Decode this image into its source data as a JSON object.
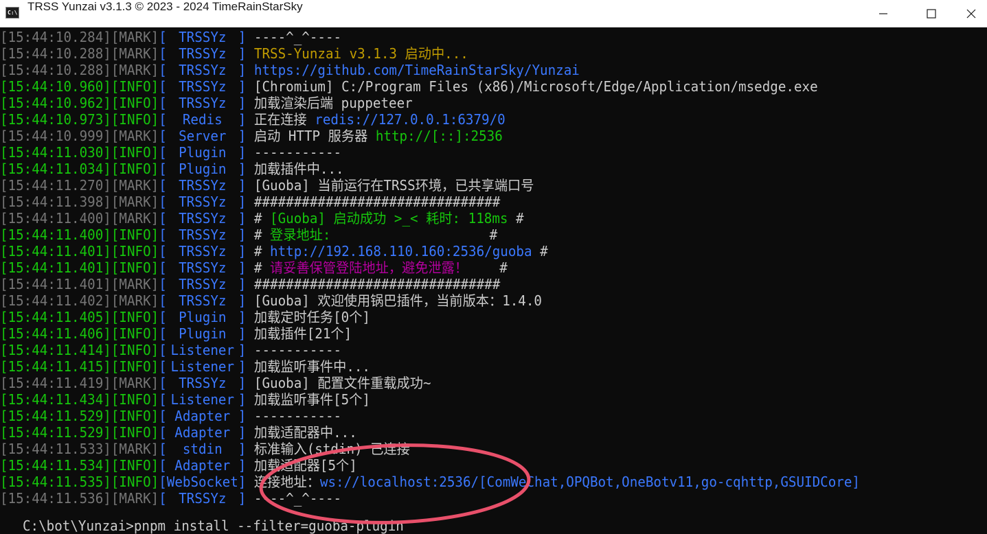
{
  "window": {
    "title": "TRSS Yunzai v3.1.3 © 2023 - 2024 TimeRainStarSky",
    "icon_text": "C:\\",
    "controls": [
      "minimize-icon",
      "maximize-icon",
      "close-icon"
    ]
  },
  "colors": {
    "timestamp": "#767676",
    "info": "#16c60c",
    "bracket_source": "#3b78ff",
    "message": "#cccccc",
    "yellow": "#c19c00",
    "link": "#3b78ff",
    "green": "#16c60c",
    "magenta": "#b4009e",
    "annotation_circle": "#e8506a"
  },
  "log": [
    {
      "time": "[15:44:10.284]",
      "level": "[MARK]",
      "source": "TRSSYz",
      "segments": [
        {
          "t": "----^_^----",
          "c": "msg"
        }
      ]
    },
    {
      "time": "[15:44:10.288]",
      "level": "[MARK]",
      "source": "TRSSYz",
      "segments": [
        {
          "t": "TRSS-Yunzai v3.1.3 启动中...",
          "c": "yellow"
        }
      ]
    },
    {
      "time": "[15:44:10.288]",
      "level": "[MARK]",
      "source": "TRSSYz",
      "segments": [
        {
          "t": "https://github.com/TimeRainStarSky/Yunzai",
          "c": "blue"
        }
      ]
    },
    {
      "time": "[15:44:10.960]",
      "level": "[INFO]",
      "source": "TRSSYz",
      "segments": [
        {
          "t": "[Chromium] C:/Program Files (x86)/Microsoft/Edge/Application/msedge.exe",
          "c": "msg"
        }
      ]
    },
    {
      "time": "[15:44:10.962]",
      "level": "[INFO]",
      "source": "TRSSYz",
      "segments": [
        {
          "t": "加载渲染后端 puppeteer",
          "c": "msg"
        }
      ]
    },
    {
      "time": "[15:44:10.973]",
      "level": "[INFO]",
      "source": "Redis",
      "segments": [
        {
          "t": "正在连接 ",
          "c": "msg"
        },
        {
          "t": "redis://127.0.0.1:6379/0",
          "c": "blue"
        }
      ]
    },
    {
      "time": "[15:44:10.999]",
      "level": "[MARK]",
      "source": "Server",
      "segments": [
        {
          "t": "启动 HTTP 服务器 ",
          "c": "msg"
        },
        {
          "t": "http://[::]:2536",
          "c": "green"
        }
      ]
    },
    {
      "time": "[15:44:11.030]",
      "level": "[INFO]",
      "source": "Plugin",
      "segments": [
        {
          "t": "-----------",
          "c": "msg"
        }
      ]
    },
    {
      "time": "[15:44:11.034]",
      "level": "[INFO]",
      "source": "Plugin",
      "segments": [
        {
          "t": "加载插件中...",
          "c": "msg"
        }
      ]
    },
    {
      "time": "[15:44:11.270]",
      "level": "[MARK]",
      "source": "TRSSYz",
      "segments": [
        {
          "t": "[Guoba] 当前运行在TRSS环境，已共享端口号",
          "c": "msg"
        }
      ]
    },
    {
      "time": "[15:44:11.398]",
      "level": "[MARK]",
      "source": "TRSSYz",
      "segments": [
        {
          "t": "###############################",
          "c": "msg"
        }
      ]
    },
    {
      "time": "[15:44:11.400]",
      "level": "[MARK]",
      "source": "TRSSYz",
      "segments": [
        {
          "t": "# ",
          "c": "msg"
        },
        {
          "t": "[Guoba] 启动成功 >_< 耗时: 118ms",
          "c": "green"
        },
        {
          "t": " #",
          "c": "msg"
        }
      ]
    },
    {
      "time": "[15:44:11.400]",
      "level": "[INFO]",
      "source": "TRSSYz",
      "segments": [
        {
          "t": "# ",
          "c": "msg"
        },
        {
          "t": "登录地址:",
          "c": "green"
        },
        {
          "t": "                    #",
          "c": "msg"
        }
      ]
    },
    {
      "time": "[15:44:11.401]",
      "level": "[INFO]",
      "source": "TRSSYz",
      "segments": [
        {
          "t": "# ",
          "c": "msg"
        },
        {
          "t": "http://192.168.110.160:2536/guoba",
          "c": "blue"
        },
        {
          "t": " #",
          "c": "msg"
        }
      ]
    },
    {
      "time": "[15:44:11.401]",
      "level": "[INFO]",
      "source": "TRSSYz",
      "segments": [
        {
          "t": "# ",
          "c": "msg"
        },
        {
          "t": "请妥善保管登陆地址，避免泄露！",
          "c": "magenta"
        },
        {
          "t": "    #",
          "c": "msg"
        }
      ]
    },
    {
      "time": "[15:44:11.401]",
      "level": "[MARK]",
      "source": "TRSSYz",
      "segments": [
        {
          "t": "###############################",
          "c": "msg"
        }
      ]
    },
    {
      "time": "[15:44:11.402]",
      "level": "[MARK]",
      "source": "TRSSYz",
      "segments": [
        {
          "t": "[Guoba] 欢迎使用锅巴插件，当前版本：1.4.0",
          "c": "msg"
        }
      ]
    },
    {
      "time": "[15:44:11.405]",
      "level": "[INFO]",
      "source": "Plugin",
      "segments": [
        {
          "t": "加载定时任务[0个]",
          "c": "msg"
        }
      ]
    },
    {
      "time": "[15:44:11.406]",
      "level": "[INFO]",
      "source": "Plugin",
      "segments": [
        {
          "t": "加载插件[21个]",
          "c": "msg"
        }
      ]
    },
    {
      "time": "[15:44:11.414]",
      "level": "[INFO]",
      "source": "Listener",
      "segments": [
        {
          "t": "-----------",
          "c": "msg"
        }
      ]
    },
    {
      "time": "[15:44:11.415]",
      "level": "[INFO]",
      "source": "Listener",
      "segments": [
        {
          "t": "加载监听事件中...",
          "c": "msg"
        }
      ]
    },
    {
      "time": "[15:44:11.419]",
      "level": "[MARK]",
      "source": "TRSSYz",
      "segments": [
        {
          "t": "[Guoba] 配置文件重载成功~",
          "c": "msg"
        }
      ]
    },
    {
      "time": "[15:44:11.434]",
      "level": "[INFO]",
      "source": "Listener",
      "segments": [
        {
          "t": "加载监听事件[5个]",
          "c": "msg"
        }
      ]
    },
    {
      "time": "[15:44:11.529]",
      "level": "[INFO]",
      "source": "Adapter",
      "segments": [
        {
          "t": "-----------",
          "c": "msg"
        }
      ]
    },
    {
      "time": "[15:44:11.529]",
      "level": "[INFO]",
      "source": "Adapter",
      "segments": [
        {
          "t": "加载适配器中...",
          "c": "msg"
        }
      ]
    },
    {
      "time": "[15:44:11.533]",
      "level": "[MARK]",
      "source": "stdin",
      "segments": [
        {
          "t": "标准输入(stdin) 已连接",
          "c": "msg"
        }
      ]
    },
    {
      "time": "[15:44:11.534]",
      "level": "[INFO]",
      "source": "Adapter",
      "segments": [
        {
          "t": "加载适配器[5个]",
          "c": "msg"
        }
      ]
    },
    {
      "time": "[15:44:11.535]",
      "level": "[INFO]",
      "source": "WebSocket",
      "segments": [
        {
          "t": "连接地址：",
          "c": "msg"
        },
        {
          "t": "ws://localhost:2536/",
          "c": "blue"
        },
        {
          "t": "[ComWeChat,OPQBot,OneBotv11,go-cqhttp,GSUIDCore]",
          "c": "blue"
        }
      ]
    },
    {
      "time": "[15:44:11.536]",
      "level": "[MARK]",
      "source": "TRSSYz",
      "segments": [
        {
          "t": "----^_^----",
          "c": "msg"
        }
      ]
    }
  ],
  "prompt": {
    "text": "C:\\bot\\Yunzai>pnpm install --filter=guoba-plugin"
  }
}
